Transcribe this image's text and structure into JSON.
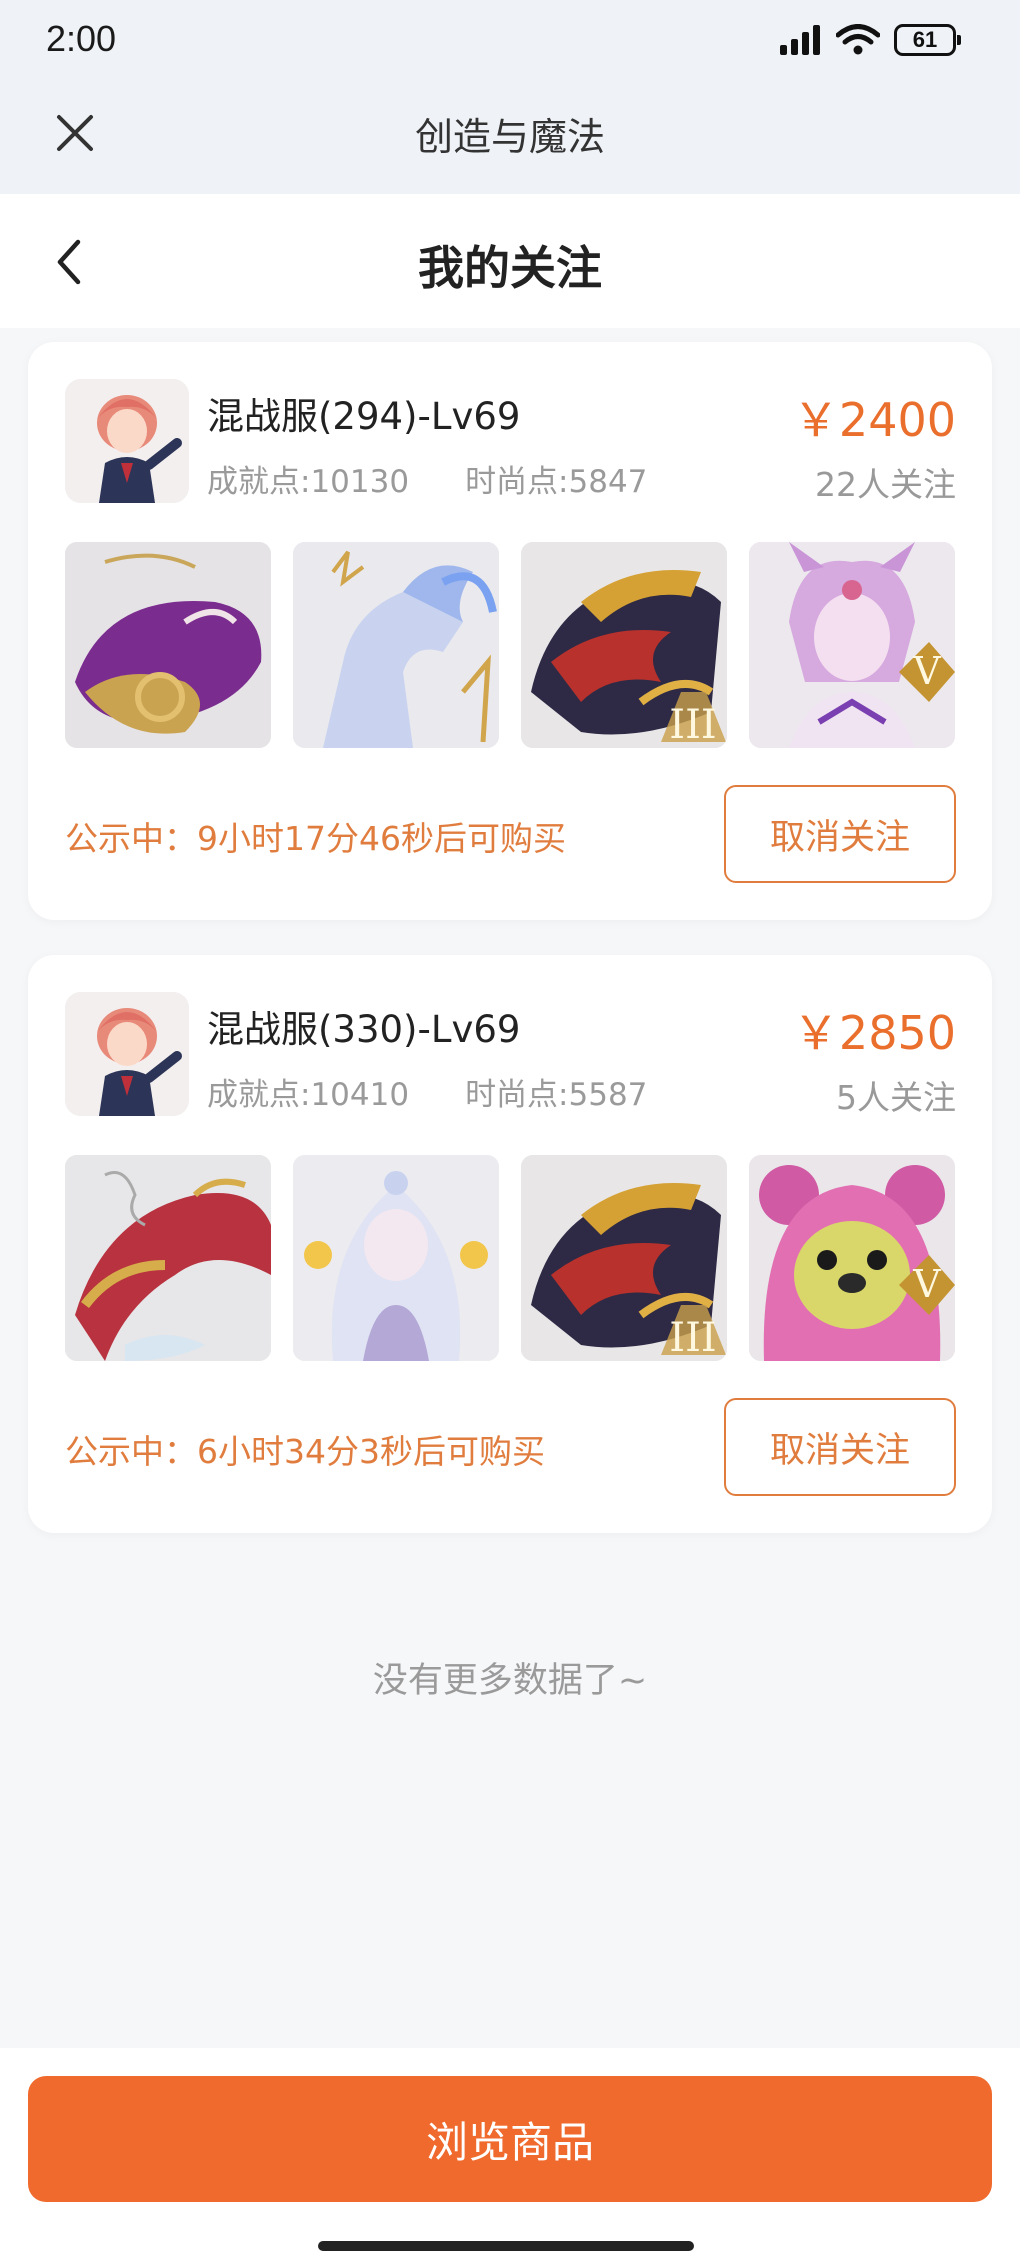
{
  "status_bar": {
    "time": "2:00",
    "battery": "61"
  },
  "app_header": {
    "title": "创造与魔法"
  },
  "page_header": {
    "title": "我的关注"
  },
  "listings": [
    {
      "server": "混战服(294)-Lv69",
      "achievement": "成就点:10130",
      "fashion": "时尚点:5847",
      "price": "￥2400",
      "followers": "22人关注",
      "notice_label": "公示中：",
      "notice_time": "9小时17分46秒后可购买",
      "unfollow_label": "取消关注",
      "thumbnails": [
        "purple-whale-mount",
        "ice-horse-mount",
        "dragon-mount-III",
        "fox-spirit-character-V"
      ]
    },
    {
      "server": "混战服(330)-Lv69",
      "achievement": "成就点:10410",
      "fashion": "时尚点:5587",
      "price": "￥2850",
      "followers": "5人关注",
      "notice_label": "公示中：",
      "notice_time": "6小时34分3秒后可购买",
      "unfollow_label": "取消关注",
      "thumbnails": [
        "red-dragon-mount",
        "silver-hair-character",
        "dragon-mount-III",
        "pink-bear-pet-V"
      ]
    }
  ],
  "footer": {
    "no_more": "没有更多数据了~",
    "browse_label": "浏览商品"
  },
  "badges": {
    "tier3": "III",
    "tier5": "V"
  },
  "colors": {
    "accent": "#ef6a2c",
    "notice": "#e07d3e",
    "header_bg": "#eff3f7",
    "page_bg": "#f6f7f9"
  }
}
